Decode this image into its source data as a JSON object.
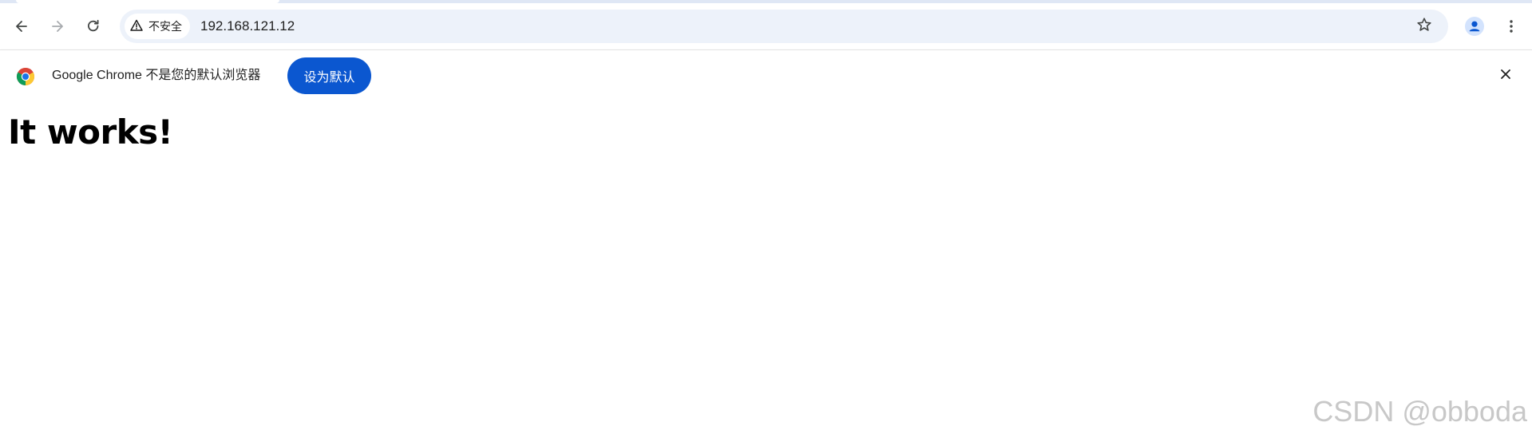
{
  "browser": {
    "nav": {
      "back_icon": "arrow-left-icon",
      "forward_icon": "arrow-right-icon",
      "reload_icon": "reload-icon"
    },
    "omnibox": {
      "security_label": "不安全",
      "security_icon": "warning-triangle-icon",
      "url": "192.168.121.12",
      "bookmark_icon": "star-outline-icon"
    },
    "profile_icon": "person-avatar-icon",
    "menu_icon": "kebab-menu-icon"
  },
  "infobar": {
    "logo_icon": "chrome-logo-icon",
    "message": "Google Chrome 不是您的默认浏览器",
    "set_default_label": "设为默认",
    "close_icon": "close-icon"
  },
  "page": {
    "heading": "It works!"
  },
  "watermark": {
    "text": "CSDN @obboda"
  },
  "colors": {
    "accent": "#0b57d0",
    "omnibox_bg": "#edf2fa",
    "text": "#1f1f1f",
    "icon": "#444746"
  }
}
